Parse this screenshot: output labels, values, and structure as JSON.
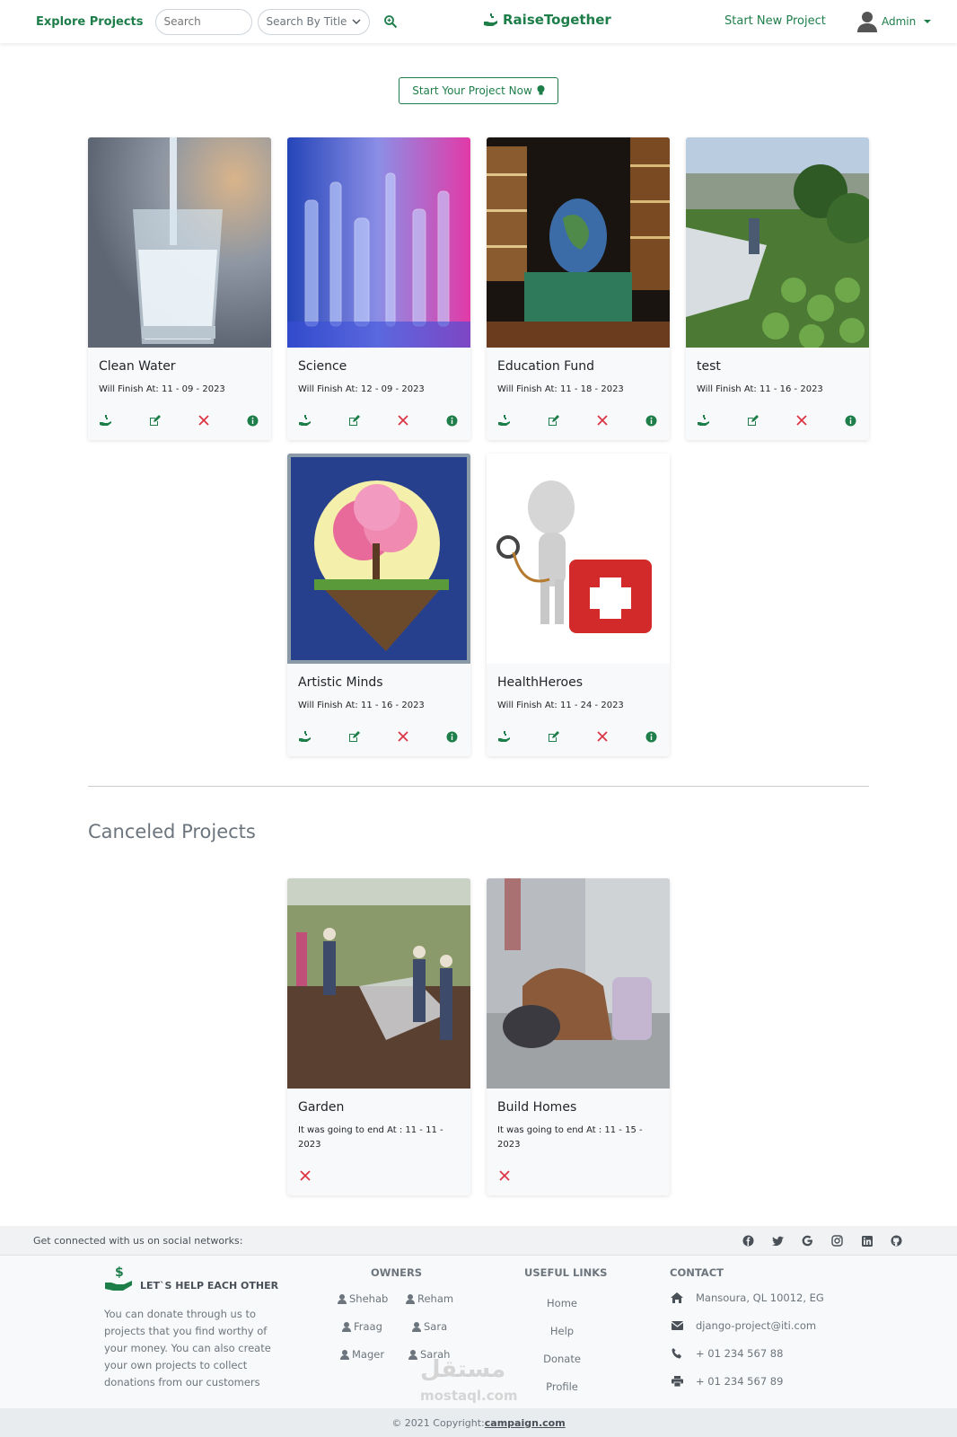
{
  "nav": {
    "explore": "Explore Projects",
    "search_placeholder": "Search",
    "search_by": "Search By Title",
    "brand": "RaiseTogether",
    "start_new": "Start New Project",
    "user": "Admin"
  },
  "start_button": "Start Your Project Now",
  "projects": [
    {
      "title": "Clean Water",
      "date": "Will Finish At: 11 - 09 - 2023"
    },
    {
      "title": "Science",
      "date": "Will Finish At: 12 - 09 - 2023"
    },
    {
      "title": "Education Fund",
      "date": "Will Finish At: 11 - 18 - 2023"
    },
    {
      "title": "test",
      "date": "Will Finish At: 11 - 16 - 2023"
    },
    {
      "title": "Artistic Minds",
      "date": "Will Finish At: 11 - 16 - 2023"
    },
    {
      "title": "HealthHeroes",
      "date": "Will Finish At: 11 - 24 - 2023"
    }
  ],
  "canceled_title": "Canceled Projects",
  "canceled": [
    {
      "title": "Garden",
      "date": "It was going to end At : 11 - 11 - 2023"
    },
    {
      "title": "Build Homes",
      "date": "It was going to end At : 11 - 15 - 2023"
    }
  ],
  "social": {
    "text": "Get connected with us on social networks:"
  },
  "footer": {
    "brand": "LET`S HELP EACH OTHER",
    "text": "You can donate through us to projects that you find worthy of your money. You can also create your own projects to collect donations from our customers",
    "owners_title": "OWNERS",
    "owners": [
      "Shehab",
      "Reham",
      "Fraag",
      "Sara",
      "Mager",
      "Sarah"
    ],
    "links_title": "USEFUL LINKS",
    "links": [
      "Home",
      "Help",
      "Donate",
      "Profile"
    ],
    "contact_title": "CONTACT",
    "address": "Mansoura, QL 10012, EG",
    "email": "django-project@iti.com",
    "phone": "+ 01 234 567 88",
    "fax": "+ 01 234 567 89"
  },
  "copyright": {
    "prefix": "© 2021 Copyright:",
    "link": "campaign.com"
  },
  "watermark": {
    "main": "مستقل",
    "sub": "mostaql.com"
  },
  "colors": {
    "accent": "#1e7e4a",
    "danger": "#dc3545"
  }
}
